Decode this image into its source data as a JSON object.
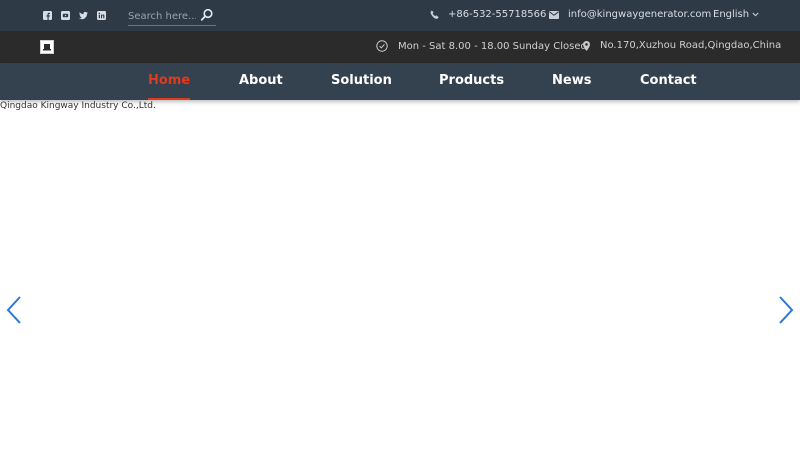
{
  "topbar": {
    "social": [
      {
        "icon": "facebook-icon"
      },
      {
        "icon": "youtube-icon"
      },
      {
        "icon": "twitter-icon"
      },
      {
        "icon": "linkedin-icon"
      }
    ],
    "search": {
      "placeholder": "Search here...",
      "value": ""
    },
    "phone": "+86-532-55718566",
    "email": "info@kingwaygenerator.com",
    "language": "English"
  },
  "infobar": {
    "hours": "Mon - Sat 8.00 - 18.00 Sunday Closed",
    "address": "No.170,Xuzhou Road,Qingdao,China"
  },
  "nav": {
    "items": [
      {
        "label": "Home",
        "active": true
      },
      {
        "label": "About"
      },
      {
        "label": "Solution"
      },
      {
        "label": "Products"
      },
      {
        "label": "News"
      },
      {
        "label": "Contact"
      }
    ]
  },
  "company": "Qingdao Kingway Industry Co.,Ltd.",
  "colors": {
    "accent": "#e03a1e",
    "arrow": "#2a78d6",
    "topbar": "#2f3a47",
    "infobar": "#2b2b2b",
    "nav": "#34414e"
  }
}
